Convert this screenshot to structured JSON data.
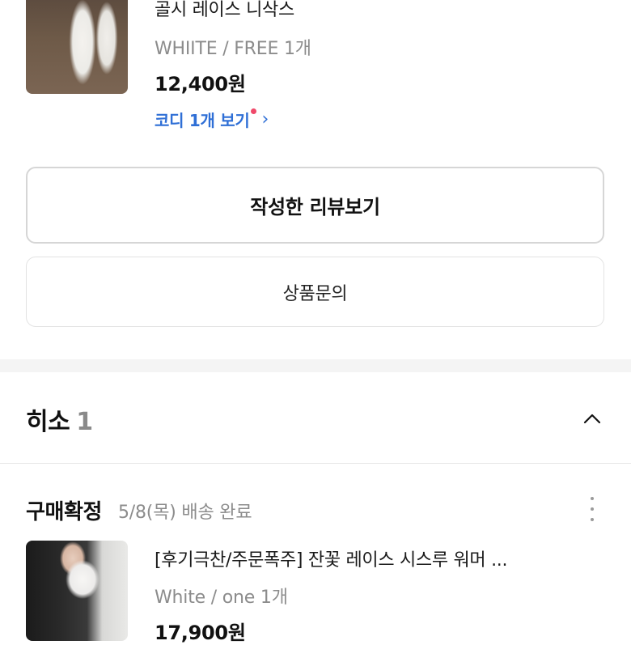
{
  "product1": {
    "title": "골시 레이스 니삭스",
    "option": "WHIITE / FREE 1개",
    "price": "12,400원",
    "coordi_link": "코디 1개 보기"
  },
  "actions": {
    "review_button": "작성한 리뷰보기",
    "inquiry_button": "상품문의"
  },
  "seller_section": {
    "name": "히소",
    "count": "1"
  },
  "order": {
    "status": "구매확정",
    "date_info": "5/8(목) 배송 완료"
  },
  "product2": {
    "title": "[후기극찬/주문폭주] 잔꽃 레이스 시스루 워머 ...",
    "option": "White / one 1개",
    "price": "17,900원"
  },
  "colors": {
    "link_blue": "#2f6fd6",
    "notification_dot": "#f0496a",
    "muted_text": "#8c8c8c"
  }
}
